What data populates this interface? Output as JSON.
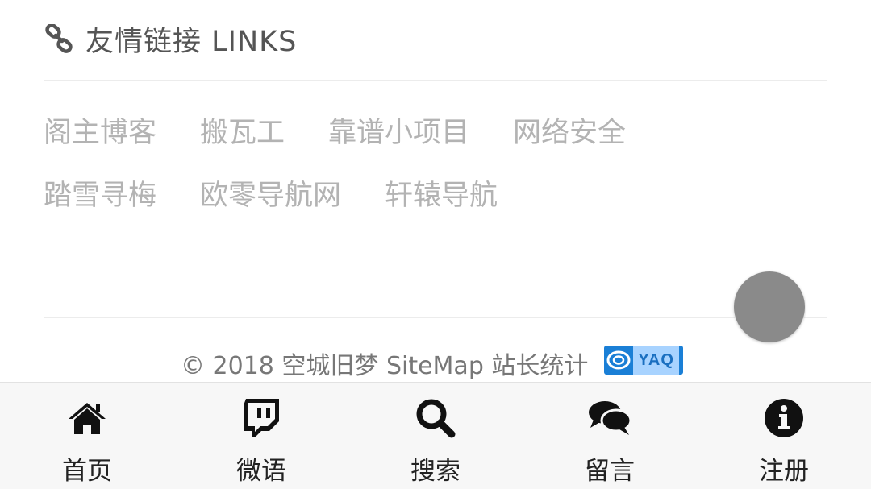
{
  "links_section": {
    "title": "友情链接 LINKS",
    "icon": "link-icon",
    "rows": [
      [
        "阁主博客",
        "搬瓦工",
        "靠谱小项目",
        "网络安全"
      ],
      [
        "踏雪寻梅",
        "欧零导航网",
        "轩辕导航"
      ]
    ]
  },
  "footer": {
    "copyright": "© 2018 空城旧梦 SiteMap 站长统计",
    "badge_text": "YAQ"
  },
  "bottom_nav": [
    {
      "label": "首页",
      "icon": "home-icon"
    },
    {
      "label": "微语",
      "icon": "twitch-icon"
    },
    {
      "label": "搜索",
      "icon": "search-icon"
    },
    {
      "label": "留言",
      "icon": "comments-icon"
    },
    {
      "label": "注册",
      "icon": "info-icon"
    }
  ],
  "colors": {
    "link_text": "#b3b3b3",
    "header_text": "#555555",
    "fab": "#8a8a8a",
    "nav_background": "#f7f7f7",
    "badge_blue": "#1a7fd6"
  }
}
